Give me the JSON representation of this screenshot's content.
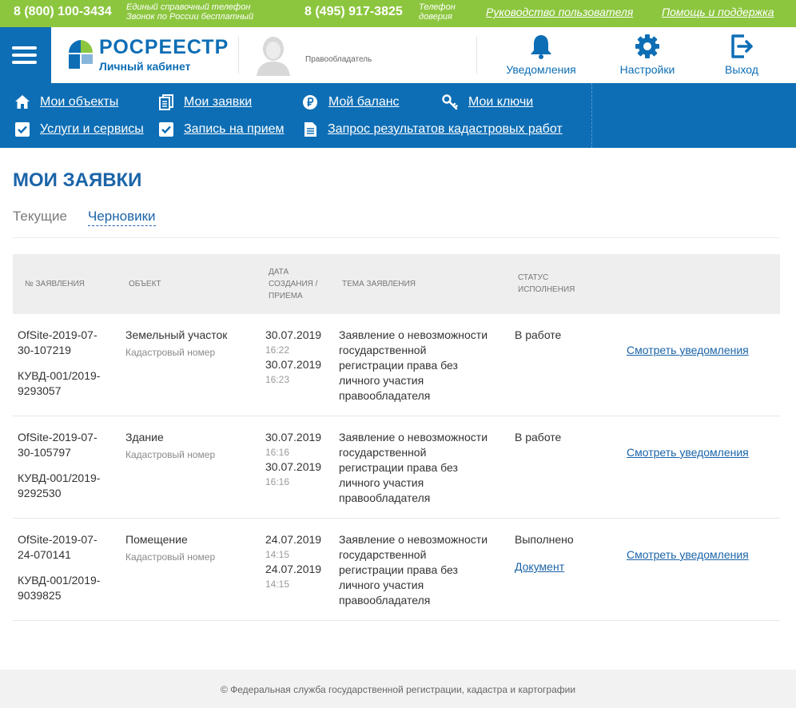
{
  "topbar": {
    "phone1": "8 (800) 100-3434",
    "phone1_note_line1": "Единый справочный телефон",
    "phone1_note_line2": "Звонок по России бесплатный",
    "phone2": "8 (495) 917-3825",
    "phone2_note_line1": "Телефон",
    "phone2_note_line2": "доверия",
    "link_guide": "Руководство пользователя",
    "link_help": "Помощь и поддержка"
  },
  "header": {
    "logo_title": "РОСРЕЕСТР",
    "logo_subtitle": "Личный кабинет",
    "role": "Правообладатель",
    "notifications_label": "Уведомления",
    "settings_label": "Настройки",
    "logout_label": "Выход"
  },
  "nav": {
    "my_objects": "Мои объекты",
    "my_requests": "Мои заявки",
    "my_balance": "Мой баланс",
    "my_keys": "Мои ключи",
    "services": "Услуги и сервисы",
    "appointment": "Запись на прием",
    "cadastral_request": "Запрос результатов кадастровых работ"
  },
  "page": {
    "title": "МОИ ЗАЯВКИ",
    "tab_current": "Текущие",
    "tab_drafts": "Черновики"
  },
  "table": {
    "headers": {
      "number": "№ ЗАЯВЛЕНИЯ",
      "object": "ОБЪЕКТ",
      "date_l1": "ДАТА",
      "date_l2": "СОЗДАНИЯ /",
      "date_l3": "ПРИЕМА",
      "topic": "ТЕМА ЗАЯВЛЕНИЯ",
      "status_l1": "СТАТУС",
      "status_l2": "ИСПОЛНЕНИЯ"
    },
    "rows": [
      {
        "num1_l1": "OfSite-2019-07-",
        "num1_l2": "30-107219",
        "num2_l1": "КУВД-001/2019-",
        "num2_l2": "9293057",
        "object": "Земельный участок",
        "cadastral": "Кадастровый номер",
        "date1": "30.07.2019",
        "time1": "16:22",
        "date2": "30.07.2019",
        "time2": "16:23",
        "topic_l1": "Заявление о невозможности",
        "topic_l2": "государственной",
        "topic_l3": "регистрации права без",
        "topic_l4": "личного участия",
        "topic_l5": "правообладателя",
        "status": "В работе",
        "doc": "",
        "action": "Смотреть уведомления"
      },
      {
        "num1_l1": "OfSite-2019-07-",
        "num1_l2": "30-105797",
        "num2_l1": "КУВД-001/2019-",
        "num2_l2": "9292530",
        "object": "Здание",
        "cadastral": "Кадастровый номер",
        "date1": "30.07.2019",
        "time1": "16:16",
        "date2": "30.07.2019",
        "time2": "16:16",
        "topic_l1": "Заявление о невозможности",
        "topic_l2": "государственной",
        "topic_l3": "регистрации права без",
        "topic_l4": "личного участия",
        "topic_l5": "правообладателя",
        "status": "В работе",
        "doc": "",
        "action": "Смотреть уведомления"
      },
      {
        "num1_l1": "OfSite-2019-07-",
        "num1_l2": "24-070141",
        "num2_l1": "КУВД-001/2019-",
        "num2_l2": "9039825",
        "object": "Помещение",
        "cadastral": "Кадастровый номер",
        "date1": "24.07.2019",
        "time1": "14:15",
        "date2": "24.07.2019",
        "time2": "14:15",
        "topic_l1": "Заявление о невозможности",
        "topic_l2": "государственной",
        "topic_l3": "регистрации права без",
        "topic_l4": "личного участия",
        "topic_l5": "правообладателя",
        "status": "Выполнено",
        "doc": "Документ",
        "action": "Смотреть уведомления"
      }
    ]
  },
  "footer": {
    "copyright": "© Федеральная служба государственной регистрации, кадастра и картографии"
  },
  "colors": {
    "topbar_green": "#8cc63f",
    "brand_blue": "#0d6eb5",
    "link_blue": "#1b64a8"
  },
  "icons": [
    "menu-icon",
    "rosreestr-logo-icon",
    "user-avatar-icon",
    "bell-icon",
    "gear-icon",
    "logout-icon",
    "home-icon",
    "document-icon",
    "ruble-icon",
    "key-icon",
    "checkbox-icon",
    "file-icon"
  ]
}
